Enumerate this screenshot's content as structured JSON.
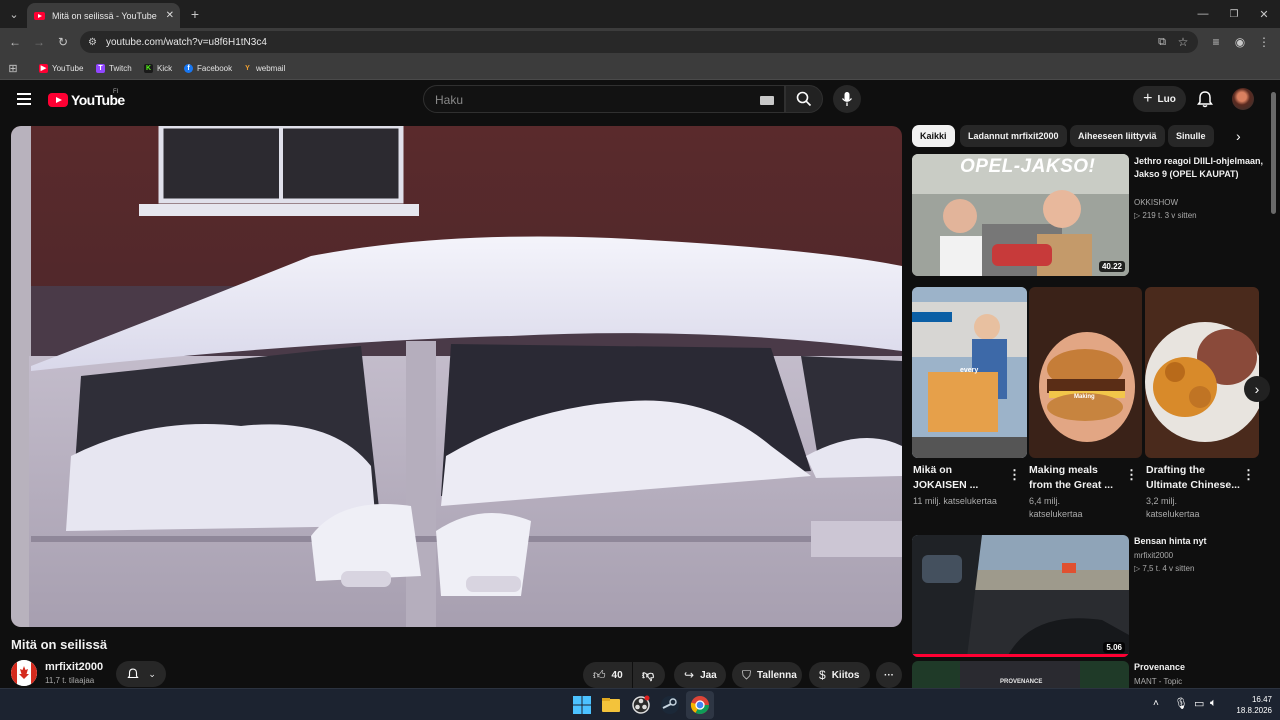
{
  "browser": {
    "tab_title": "Mitä on seilissä - YouTube",
    "url": "youtube.com/watch?v=u8f6H1tN3c4",
    "bookmarks": [
      "YouTube",
      "Twitch",
      "Kick",
      "Facebook",
      "webmail"
    ]
  },
  "header": {
    "logo": "YouTube",
    "region": "FI",
    "search_placeholder": "Haku",
    "create_label": "Luo"
  },
  "video": {
    "title": "Mitä on seilissä",
    "channel": "mrfixit2000",
    "subscribers": "11,7 t. tilaajaa",
    "likes": "40",
    "share": "Jaa",
    "save": "Tallenna",
    "thanks": "Kiitos"
  },
  "chips": [
    "Kaikki",
    "Ladannut mrfixit2000",
    "Aiheeseen liittyviä",
    "Sinulle"
  ],
  "related": [
    {
      "title": "Jethro reagoi DIILI-ohjelmaan, Jakso 9 (OPEL KAUPAT)",
      "channel": "OKKISHOW",
      "meta": "▷ 219 t.   3 v sitten",
      "duration": "40.22",
      "overlay": "OPEL-JAKSO!"
    },
    {
      "title": "Bensan hinta nyt",
      "channel": "mrfixit2000",
      "meta": "▷ 7,5 t.   4 v sitten",
      "duration": "5.06"
    },
    {
      "title": "Provenance",
      "channel": "MANT - Topic",
      "overlay": "PROVENANCE"
    }
  ],
  "shorts": [
    {
      "title_l1": "Mikä on",
      "title_l2": "JOKAISEN ...",
      "views_l1": "11 milj. katselukertaa",
      "views_l2": "",
      "overlay": "every"
    },
    {
      "title_l1": "Making meals",
      "title_l2": "from the Great ...",
      "views_l1": "6,4 milj.",
      "views_l2": "katselukertaa",
      "overlay": "Making"
    },
    {
      "title_l1": "Drafting the",
      "title_l2": "Ultimate Chinese...",
      "views_l1": "3,2 milj.",
      "views_l2": "katselukertaa"
    }
  ],
  "taskbar": {
    "time": "16.47",
    "date": "18.8.2026"
  },
  "colors": {
    "background": "#0f0f0f",
    "accent": "#ff0033",
    "chip_active": "#f1f1f1"
  }
}
